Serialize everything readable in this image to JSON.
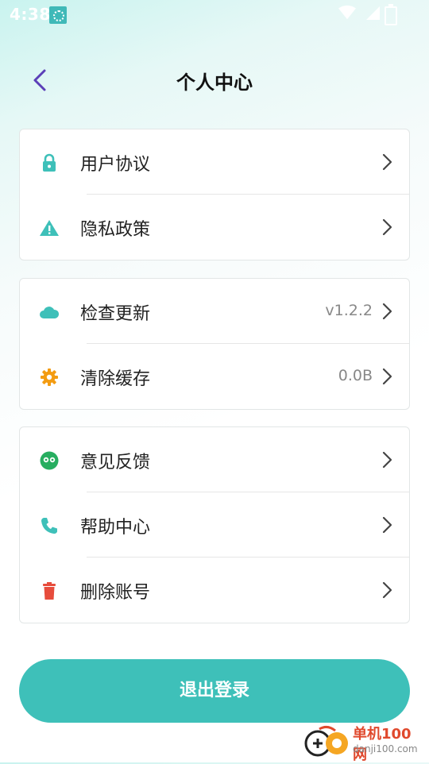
{
  "status_bar": {
    "time": "4:38"
  },
  "header": {
    "title": "个人中心"
  },
  "groups": [
    {
      "items": [
        {
          "label": "用户协议",
          "icon": "lock-icon",
          "icon_color": "#3ec0b9"
        },
        {
          "label": "隐私政策",
          "icon": "warning-icon",
          "icon_color": "#3ec0b9"
        }
      ]
    },
    {
      "items": [
        {
          "label": "检查更新",
          "icon": "cloud-icon",
          "icon_color": "#3ec0b9",
          "value": "v1.2.2"
        },
        {
          "label": "清除缓存",
          "icon": "gear-icon",
          "icon_color": "#f39c12",
          "value": "0.0B"
        }
      ]
    },
    {
      "items": [
        {
          "label": "意见反馈",
          "icon": "feedback-icon",
          "icon_color": "#27ae60"
        },
        {
          "label": "帮助中心",
          "icon": "phone-icon",
          "icon_color": "#3ec0b9"
        },
        {
          "label": "删除账号",
          "icon": "trash-icon",
          "icon_color": "#e74c3c"
        }
      ]
    }
  ],
  "logout": {
    "label": "退出登录"
  },
  "watermark": {
    "name": "单机100网",
    "url": "danji100.com"
  }
}
